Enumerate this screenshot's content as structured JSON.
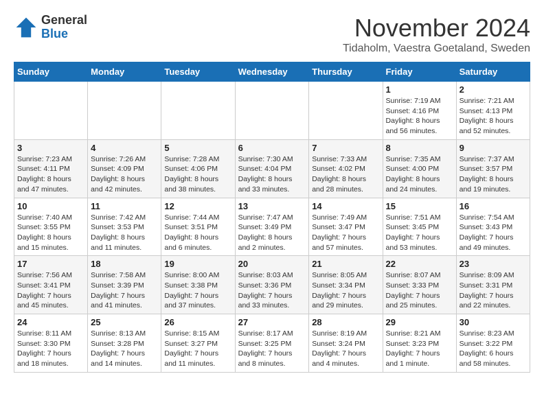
{
  "logo": {
    "general": "General",
    "blue": "Blue"
  },
  "header": {
    "month": "November 2024",
    "location": "Tidaholm, Vaestra Goetaland, Sweden"
  },
  "weekdays": [
    "Sunday",
    "Monday",
    "Tuesday",
    "Wednesday",
    "Thursday",
    "Friday",
    "Saturday"
  ],
  "weeks": [
    [
      {
        "day": "",
        "sunrise": "",
        "sunset": "",
        "daylight": ""
      },
      {
        "day": "",
        "sunrise": "",
        "sunset": "",
        "daylight": ""
      },
      {
        "day": "",
        "sunrise": "",
        "sunset": "",
        "daylight": ""
      },
      {
        "day": "",
        "sunrise": "",
        "sunset": "",
        "daylight": ""
      },
      {
        "day": "",
        "sunrise": "",
        "sunset": "",
        "daylight": ""
      },
      {
        "day": "1",
        "sunrise": "Sunrise: 7:19 AM",
        "sunset": "Sunset: 4:16 PM",
        "daylight": "Daylight: 8 hours and 56 minutes."
      },
      {
        "day": "2",
        "sunrise": "Sunrise: 7:21 AM",
        "sunset": "Sunset: 4:13 PM",
        "daylight": "Daylight: 8 hours and 52 minutes."
      }
    ],
    [
      {
        "day": "3",
        "sunrise": "Sunrise: 7:23 AM",
        "sunset": "Sunset: 4:11 PM",
        "daylight": "Daylight: 8 hours and 47 minutes."
      },
      {
        "day": "4",
        "sunrise": "Sunrise: 7:26 AM",
        "sunset": "Sunset: 4:09 PM",
        "daylight": "Daylight: 8 hours and 42 minutes."
      },
      {
        "day": "5",
        "sunrise": "Sunrise: 7:28 AM",
        "sunset": "Sunset: 4:06 PM",
        "daylight": "Daylight: 8 hours and 38 minutes."
      },
      {
        "day": "6",
        "sunrise": "Sunrise: 7:30 AM",
        "sunset": "Sunset: 4:04 PM",
        "daylight": "Daylight: 8 hours and 33 minutes."
      },
      {
        "day": "7",
        "sunrise": "Sunrise: 7:33 AM",
        "sunset": "Sunset: 4:02 PM",
        "daylight": "Daylight: 8 hours and 28 minutes."
      },
      {
        "day": "8",
        "sunrise": "Sunrise: 7:35 AM",
        "sunset": "Sunset: 4:00 PM",
        "daylight": "Daylight: 8 hours and 24 minutes."
      },
      {
        "day": "9",
        "sunrise": "Sunrise: 7:37 AM",
        "sunset": "Sunset: 3:57 PM",
        "daylight": "Daylight: 8 hours and 19 minutes."
      }
    ],
    [
      {
        "day": "10",
        "sunrise": "Sunrise: 7:40 AM",
        "sunset": "Sunset: 3:55 PM",
        "daylight": "Daylight: 8 hours and 15 minutes."
      },
      {
        "day": "11",
        "sunrise": "Sunrise: 7:42 AM",
        "sunset": "Sunset: 3:53 PM",
        "daylight": "Daylight: 8 hours and 11 minutes."
      },
      {
        "day": "12",
        "sunrise": "Sunrise: 7:44 AM",
        "sunset": "Sunset: 3:51 PM",
        "daylight": "Daylight: 8 hours and 6 minutes."
      },
      {
        "day": "13",
        "sunrise": "Sunrise: 7:47 AM",
        "sunset": "Sunset: 3:49 PM",
        "daylight": "Daylight: 8 hours and 2 minutes."
      },
      {
        "day": "14",
        "sunrise": "Sunrise: 7:49 AM",
        "sunset": "Sunset: 3:47 PM",
        "daylight": "Daylight: 7 hours and 57 minutes."
      },
      {
        "day": "15",
        "sunrise": "Sunrise: 7:51 AM",
        "sunset": "Sunset: 3:45 PM",
        "daylight": "Daylight: 7 hours and 53 minutes."
      },
      {
        "day": "16",
        "sunrise": "Sunrise: 7:54 AM",
        "sunset": "Sunset: 3:43 PM",
        "daylight": "Daylight: 7 hours and 49 minutes."
      }
    ],
    [
      {
        "day": "17",
        "sunrise": "Sunrise: 7:56 AM",
        "sunset": "Sunset: 3:41 PM",
        "daylight": "Daylight: 7 hours and 45 minutes."
      },
      {
        "day": "18",
        "sunrise": "Sunrise: 7:58 AM",
        "sunset": "Sunset: 3:39 PM",
        "daylight": "Daylight: 7 hours and 41 minutes."
      },
      {
        "day": "19",
        "sunrise": "Sunrise: 8:00 AM",
        "sunset": "Sunset: 3:38 PM",
        "daylight": "Daylight: 7 hours and 37 minutes."
      },
      {
        "day": "20",
        "sunrise": "Sunrise: 8:03 AM",
        "sunset": "Sunset: 3:36 PM",
        "daylight": "Daylight: 7 hours and 33 minutes."
      },
      {
        "day": "21",
        "sunrise": "Sunrise: 8:05 AM",
        "sunset": "Sunset: 3:34 PM",
        "daylight": "Daylight: 7 hours and 29 minutes."
      },
      {
        "day": "22",
        "sunrise": "Sunrise: 8:07 AM",
        "sunset": "Sunset: 3:33 PM",
        "daylight": "Daylight: 7 hours and 25 minutes."
      },
      {
        "day": "23",
        "sunrise": "Sunrise: 8:09 AM",
        "sunset": "Sunset: 3:31 PM",
        "daylight": "Daylight: 7 hours and 22 minutes."
      }
    ],
    [
      {
        "day": "24",
        "sunrise": "Sunrise: 8:11 AM",
        "sunset": "Sunset: 3:30 PM",
        "daylight": "Daylight: 7 hours and 18 minutes."
      },
      {
        "day": "25",
        "sunrise": "Sunrise: 8:13 AM",
        "sunset": "Sunset: 3:28 PM",
        "daylight": "Daylight: 7 hours and 14 minutes."
      },
      {
        "day": "26",
        "sunrise": "Sunrise: 8:15 AM",
        "sunset": "Sunset: 3:27 PM",
        "daylight": "Daylight: 7 hours and 11 minutes."
      },
      {
        "day": "27",
        "sunrise": "Sunrise: 8:17 AM",
        "sunset": "Sunset: 3:25 PM",
        "daylight": "Daylight: 7 hours and 8 minutes."
      },
      {
        "day": "28",
        "sunrise": "Sunrise: 8:19 AM",
        "sunset": "Sunset: 3:24 PM",
        "daylight": "Daylight: 7 hours and 4 minutes."
      },
      {
        "day": "29",
        "sunrise": "Sunrise: 8:21 AM",
        "sunset": "Sunset: 3:23 PM",
        "daylight": "Daylight: 7 hours and 1 minute."
      },
      {
        "day": "30",
        "sunrise": "Sunrise: 8:23 AM",
        "sunset": "Sunset: 3:22 PM",
        "daylight": "Daylight: 6 hours and 58 minutes."
      }
    ]
  ]
}
